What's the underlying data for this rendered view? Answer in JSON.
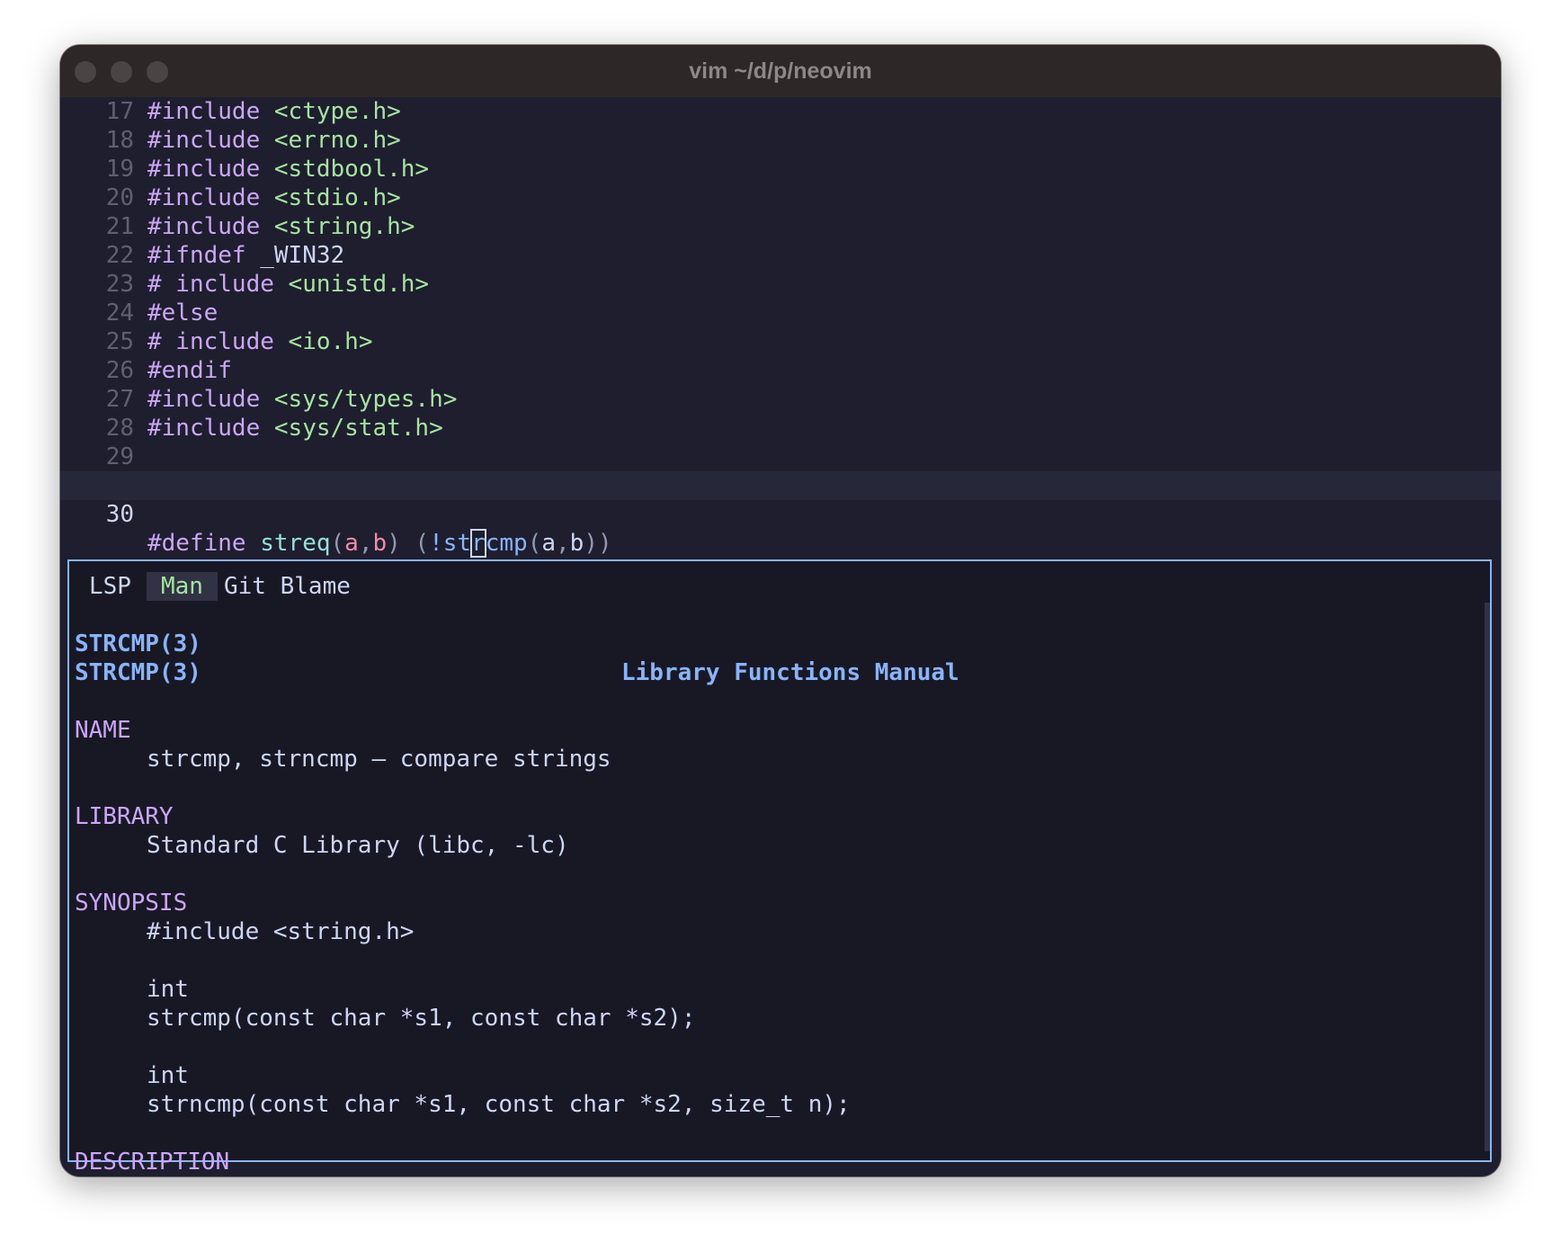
{
  "window": {
    "title": "vim ~/d/p/neovim"
  },
  "editor": {
    "lines": [
      {
        "num": "17",
        "kw": "#include",
        "rest": "<ctype.h>"
      },
      {
        "num": "18",
        "kw": "#include",
        "rest": "<errno.h>"
      },
      {
        "num": "19",
        "kw": "#include",
        "rest": "<stdbool.h>"
      },
      {
        "num": "20",
        "kw": "#include",
        "rest": "<stdio.h>"
      },
      {
        "num": "21",
        "kw": "#include",
        "rest": "<string.h>"
      },
      {
        "num": "22",
        "kw": "#ifndef",
        "rest": "_WIN32"
      },
      {
        "num": "23",
        "kw": "# include",
        "rest": "<unistd.h>"
      },
      {
        "num": "24",
        "kw": "#else",
        "rest": ""
      },
      {
        "num": "25",
        "kw": "# include",
        "rest": "<io.h>"
      },
      {
        "num": "26",
        "kw": "#endif",
        "rest": ""
      },
      {
        "num": "27",
        "kw": "#include",
        "rest": "<sys/types.h>"
      },
      {
        "num": "28",
        "kw": "#include",
        "rest": "<sys/stat.h>"
      },
      {
        "num": "29",
        "kw": "",
        "rest": ""
      }
    ],
    "current_line": {
      "num": "30",
      "define": "#define",
      "macro": "streq",
      "open1": "(",
      "param_a": "a",
      "comma1": ",",
      "param_b": "b",
      "close1": ")",
      "open2": "(",
      "bang": "!",
      "fn_pre": "st",
      "fn_cursor": "r",
      "fn_post": "cmp",
      "open3": "(",
      "arg_a": "a",
      "comma2": ",",
      "arg_b": "b",
      "close3": "))"
    }
  },
  "hover": {
    "tabs": [
      "LSP",
      "Man",
      "Git Blame"
    ],
    "active_tab": "Man",
    "header_left": "STRCMP(3)",
    "header_center": "Library Functions Manual",
    "header_right": "STRCMP(3)",
    "sections": {
      "name_title": "NAME",
      "name_body": "strcmp, strncmp – compare strings",
      "library_title": "LIBRARY",
      "library_body": "Standard C Library (libc, -lc)",
      "synopsis_title": "SYNOPSIS",
      "synopsis_include": "#include <string.h>",
      "synopsis_int1": "int",
      "synopsis_strcmp": "strcmp(const char *s1, const char *s2);",
      "synopsis_int2": "int",
      "synopsis_strncmp": "strncmp(const char *s1, const char *s2, size_t n);",
      "description_title": "DESCRIPTION"
    }
  },
  "colors": {
    "background": "#1e1e2e",
    "keyword": "#cba6f7",
    "string": "#a6e3a1",
    "function": "#89b4fa",
    "border": "#89b4fa"
  }
}
